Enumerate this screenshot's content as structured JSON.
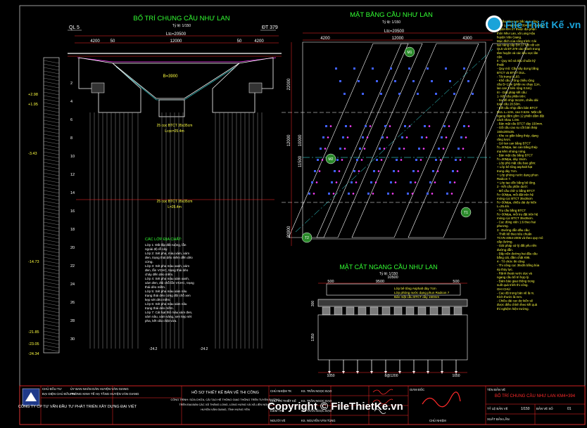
{
  "colors": {
    "background": "#000000",
    "red": "#ff2a2a",
    "green": "#33ff33",
    "yellow": "#ffff40",
    "cyan": "#40ffff",
    "magenta": "#ff40ff",
    "blue": "#4060ff",
    "white": "#ffffff",
    "grey": "#9a9a9a"
  },
  "elevation": {
    "title": "BỐ TRÍ CHUNG CẦU NHƯ LAN",
    "scale": "Tỷ lệ: 1/150",
    "ql": "QL 5",
    "dt": "ĐT 379",
    "ltoan": "Ltc=20500",
    "dims_top": [
      "4200",
      "50",
      "12000",
      "50",
      "4200"
    ],
    "span_label": "B=3900",
    "pile_note": "25 cọc BTCT 35x35cm",
    "pile_len": "L=25.4m",
    "pile_note_center": "25 cọc BTCT 35x35cm",
    "pile_len_center": "Lcọc=25.4m",
    "elevations": [
      "+2.98",
      "+1.95",
      "-3.43",
      "-14.73",
      "-21.85",
      "-23.05",
      "-24.34"
    ],
    "depths": [
      "2",
      "4",
      "6",
      "8",
      "10",
      "12",
      "14",
      "16",
      "18",
      "20",
      "22",
      "24",
      "26",
      "28",
      "30"
    ],
    "layers_title": "CÁC LỚP ĐỊA CHẤT:",
    "layers": [
      "Lớp 1: Đất lấp đất ruộng, lẫn ngoài độ rễ cây.",
      "Lớp 2: Sét pha, màu xám, xám đen, trạng thái dẻo mềm đến dẻo cứng.",
      "Lớp 3: Sét pha màu xanh, xám đen, lẫn VCHC, trạng thái dẻo chảy đến dẻo mềm.",
      "Lớp 4: Sét pha màu xám xanh, xám đen, đôi chỗ lẫn VCHC, trạng thái dẻo mềm.",
      "Lớp 5: Sét pha màu xám nâu trạng thái dẻo cứng đôi chỗ xen kẹp sét dẻo mềm.",
      "Lớp 6: Sét pha màu xám nâu trạng thái dẻo mềm.",
      "Lớp 7: Cát hạt thô màu xám đen, xám nâu, xám vàng, xen kẹp sét pha, kết cấu chặt vừa."
    ],
    "bottom_left_label": "-24.2",
    "bottom_right_label": "-24.2"
  },
  "plan": {
    "title": "MẶT BẰNG CẦU NHƯ LAN",
    "scale": "Tỷ lệ: 1/150",
    "ltoan": "Ltc=20500",
    "dims_top": [
      "4200",
      "12000",
      "4300"
    ],
    "dims_left": [
      "22000",
      "12000",
      "11500",
      "10000",
      "20900"
    ],
    "labels": [
      "M1",
      "T1",
      "M2",
      "T2"
    ]
  },
  "section": {
    "title": "MẶT CẮT NGANG CẦU NHƯ LAN",
    "scale": "Tỷ lệ: 1/150",
    "dims_top": [
      "500",
      "9500",
      "500"
    ],
    "total": "10500",
    "notes": [
      "Lớp bê tông Asphalt dày 7cm",
      "Lớp phòng nước dạng phun Radcon 7",
      "Bản mặt cầu BTCT dày 150mm"
    ],
    "dims_bottom": [
      "1050",
      "8@1200",
      "1050"
    ],
    "heights": [
      "1350",
      "300"
    ]
  },
  "notes": {
    "paragraphs": [
      "1. Cầu Như Lan bắc qua sông Như Lan tại Km4+394 trên đường huyện ĐH.17 thuộc địa phận thôn Như Lan, xã Long Hậu huyện Văn Giang.",
      "Mục đích của công trình: Cải tạo nâng cấp ĐH.17 kết nối với QL5 và ĐT.379 vào thành trung tâm huyện và các khu vực lân cận.",
      "II - Quy mô và tiêu chuẩn kỹ thuật",
      "- Quy mô: Cầu xây dựng bằng BTCT và BTCT DUL.",
      "- Tải trọng HL93.",
      "- Khổ cầu: Tổng chiều rộng cầu B=12m (phần xe chạy 11m, lan can 2 bên rộng 0.5m).",
      "III - Giải pháp kết cấu:",
      "1- Kết cấu phần trên:",
      "- Sơ đồ nhịp 3x12m, chiều dài toàn cầu 20.50m.",
      "- Kết cấu nhịp dầm bản BTCT DUL L=12m, cao 0.52m. Mặt cắt ngang dầm gồm 12 phiến dầm đặt cách nhau 1.0m.",
      "- Bản mặt cầu BTCT dày 150mm.",
      "- Gối cầu cao su cốt bản thép 150x200x35.",
      "- Khe co giãn bằng thép, dạng răng lược.",
      "- Gờ lan can bằng BTCT f'c=30Mpa, lan can bằng thép mạ kẽm nhúng nóng.",
      "- Bản mặt cầu bằng BTCT f'c=30Mpa, dày 15cm.",
      "- Lớp phủ mặt cầu bao gồm:",
      "+ Lớp bê tông asphalt hạt trung dày 7cm.",
      "+ Lớp phòng nước dạng phun Radcon 7.",
      "+ Lớp tạo dốc bằng bê tông.",
      "2 - Kết cấu phần dưới:",
      "- Mố cầu chữ U bằng BTCT f'c=30Mpa, mỗi đặt trên hệ móng cọc BTCT 35x35cm f'c=30Mpa, chiều dài dự kiến L=25.4m.",
      "- Trụ cầu bằng BTCT f'c=30Mpa, mỗi trụ đặt trên hệ móng cọc BTCT 35x35cm.",
      "- Cọc đóng xiên 1:6 theo hai phương.",
      "3 - Đường dẫn đầu cầu:",
      "- Thiết kế theo tiêu chuẩn TCVN 4054-2005 và theo quy mô cấp đường.",
      "- Giải pháp xử lý đất yếu nền đường dẫn.",
      "- Đắp nền đường hai đầu cầu bằng cát, đầm chặt K95.",
      "4 - Tổ chức thi công:",
      "- Thi công cọc 35x35 bằng búa ép thủy lực.",
      "- Rãnh thoát nước dọc và ngang cầu bố trí hợp lý.",
      "- Đảm bảo giao thông trong suốt quá trình thi công.",
      "GHI CHÚ:",
      "- Cao độ trong bản vẽ là m. Kích thước là mm.",
      "- Chiều dài cọc dự kiến sẽ được điều chỉnh theo kết quả thí nghiệm hiện trường."
    ]
  },
  "titleblock": {
    "company": "CÔNG TY CP TƯ VẤN ĐẦU TƯ PHÁT TRIỂN XÂY DỰNG ĐẠI VIỆT",
    "owner_rows": [
      "CHỦ ĐẦU TƯ",
      "ĐẠI DIỆN CHỦ ĐẦU TƯ"
    ],
    "owner_values": [
      "ỦY BAN NHÂN DÂN HUYỆN VĂN GIANG",
      "PHÒNG KINH TẾ HẠ TẦNG HUYỆN VĂN GIANG"
    ],
    "project_title": "HỒ SƠ THIẾT KẾ BẢN VẼ THI CÔNG",
    "project_sub": [
      "CÔNG TRÌNH: SỬA CHỮA, CẢI TẠO HỆ THỐNG GIAO THÔNG TRÊN TUYẾN ĐƯỜNG",
      "TRÊN ĐỊA BÀN CÁC XÃ THĂNG LONG, LONG HƯNG VÀ XÃ LIÊN NGHĨA",
      "HUYỆN VĂN GIANG, TỈNH HƯNG YÊN"
    ],
    "roles": [
      "CHỦ NHIỆM TK",
      "CHỦ TRÌ THIẾT KẾ",
      "KIỂM TRA",
      "NGƯỜI VẼ"
    ],
    "names": [
      "KS. TRẦN NGỌC ĐẠO",
      "KS. TRẦN NGỌC ĐẠO",
      "KS. TRẦN NGỌC ĐẠO",
      "KS. NGUYỄN VĂN TÙNG"
    ],
    "sheet_label": "TÊN BẢN VẼ",
    "sheet_title": "BỐ TRÍ CHUNG CẦU NHƯ LAN KM4+394",
    "ratio_label": "TỶ LỆ BẢN VẼ",
    "ratio_value": "1/150",
    "sheet_no_label": "BẢN VẼ SỐ",
    "sheet_no_value": "01",
    "date_label": "XUẤT BẢN LẦN",
    "approve": "GIÁM ĐỐC",
    "director": "CHỦ NHIỆM"
  },
  "watermark": {
    "logo_text": "File Thiết Kế .vn",
    "bottom_text": "Copyright © FileThietKe.vn"
  }
}
